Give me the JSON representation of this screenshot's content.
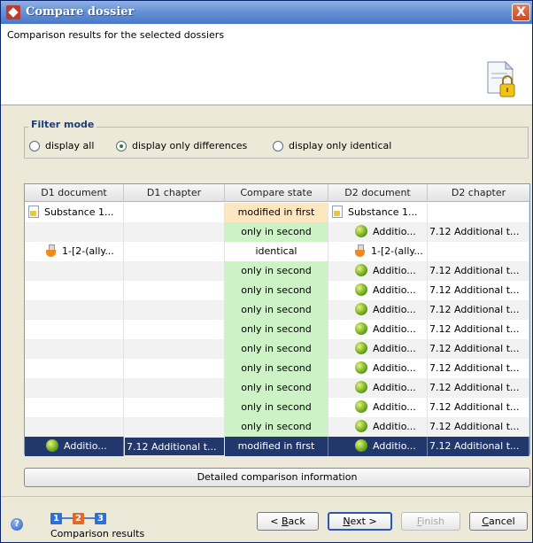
{
  "window": {
    "title": "Compare dossier",
    "close_label": "X"
  },
  "header": {
    "description": "Comparison results for the selected dossiers"
  },
  "filter": {
    "legend": "Filter mode",
    "options": [
      {
        "label": "display all",
        "checked": false
      },
      {
        "label": "display only differences",
        "checked": true
      },
      {
        "label": "display only identical",
        "checked": false
      }
    ]
  },
  "table": {
    "columns": [
      "D1 document",
      "D1 chapter",
      "Compare state",
      "D2 document",
      "D2 chapter"
    ],
    "rows": [
      {
        "d1_doc": "Substance 1...",
        "d1_icon": "doc",
        "d1_chapter": "",
        "state": "modified in first",
        "state_kind": "mod",
        "d2_doc": "Substance 1...",
        "d2_icon": "doc",
        "d2_chapter": ""
      },
      {
        "d1_doc": "",
        "d1_icon": "",
        "d1_chapter": "",
        "state": "only in second",
        "state_kind": "diff",
        "d2_doc": "Additio...",
        "d2_icon": "ball",
        "d2_chapter": "7.12 Additional t..."
      },
      {
        "d1_doc": "1-[2-(ally...",
        "d1_icon": "flask",
        "d1_chapter": "",
        "state": "identical",
        "state_kind": "ident",
        "d2_doc": "1-[2-(ally...",
        "d2_icon": "flask",
        "d2_chapter": ""
      },
      {
        "d1_doc": "",
        "d1_icon": "",
        "d1_chapter": "",
        "state": "only in second",
        "state_kind": "diff",
        "d2_doc": "Additio...",
        "d2_icon": "ball",
        "d2_chapter": "7.12 Additional t..."
      },
      {
        "d1_doc": "",
        "d1_icon": "",
        "d1_chapter": "",
        "state": "only in second",
        "state_kind": "diff",
        "d2_doc": "Additio...",
        "d2_icon": "ball",
        "d2_chapter": "7.12 Additional t..."
      },
      {
        "d1_doc": "",
        "d1_icon": "",
        "d1_chapter": "",
        "state": "only in second",
        "state_kind": "diff",
        "d2_doc": "Additio...",
        "d2_icon": "ball",
        "d2_chapter": "7.12 Additional t..."
      },
      {
        "d1_doc": "",
        "d1_icon": "",
        "d1_chapter": "",
        "state": "only in second",
        "state_kind": "diff",
        "d2_doc": "Additio...",
        "d2_icon": "ball",
        "d2_chapter": "7.12 Additional t..."
      },
      {
        "d1_doc": "",
        "d1_icon": "",
        "d1_chapter": "",
        "state": "only in second",
        "state_kind": "diff",
        "d2_doc": "Additio...",
        "d2_icon": "ball",
        "d2_chapter": "7.12 Additional t..."
      },
      {
        "d1_doc": "",
        "d1_icon": "",
        "d1_chapter": "",
        "state": "only in second",
        "state_kind": "diff",
        "d2_doc": "Additio...",
        "d2_icon": "ball",
        "d2_chapter": "7.12 Additional t..."
      },
      {
        "d1_doc": "",
        "d1_icon": "",
        "d1_chapter": "",
        "state": "only in second",
        "state_kind": "diff",
        "d2_doc": "Additio...",
        "d2_icon": "ball",
        "d2_chapter": "7.12 Additional t..."
      },
      {
        "d1_doc": "",
        "d1_icon": "",
        "d1_chapter": "",
        "state": "only in second",
        "state_kind": "diff",
        "d2_doc": "Additio...",
        "d2_icon": "ball",
        "d2_chapter": "7.12 Additional t..."
      },
      {
        "d1_doc": "",
        "d1_icon": "",
        "d1_chapter": "",
        "state": "only in second",
        "state_kind": "diff",
        "d2_doc": "Additio...",
        "d2_icon": "ball",
        "d2_chapter": "7.12 Additional t..."
      },
      {
        "d1_doc": "Additio...",
        "d1_icon": "ball",
        "d1_chapter": "7.12 Additional t...",
        "state": "modified in first",
        "state_kind": "mod",
        "d2_doc": "Additio...",
        "d2_icon": "ball",
        "d2_chapter": "7.12 Additional t...",
        "selected": true
      }
    ]
  },
  "details_button": "Detailed comparison information",
  "wizard": {
    "steps": [
      "1",
      "2",
      "3"
    ],
    "active_step": 2,
    "step_label": "Comparison results"
  },
  "buttons": {
    "back": {
      "prefix": "< ",
      "mnemonic": "B",
      "rest": "ack"
    },
    "next": {
      "mnemonic": "N",
      "rest": "ext >"
    },
    "finish": {
      "mnemonic": "F",
      "rest": "inish"
    },
    "cancel": {
      "mnemonic": "C",
      "rest": "ancel"
    }
  },
  "icons": {
    "app": "app-logo-icon",
    "header": "locked-document-icon",
    "help": "help-icon",
    "doc": "document-icon",
    "ball": "substance-ball-icon",
    "flask": "flask-icon"
  }
}
